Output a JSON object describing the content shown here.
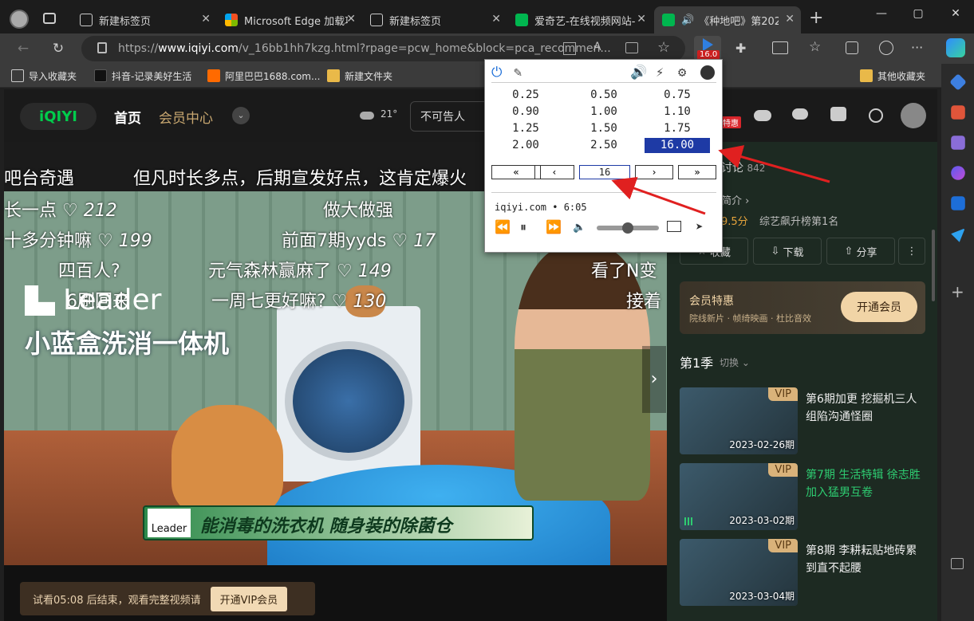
{
  "browser": {
    "tabs": [
      {
        "label": "新建标签页",
        "icon": "new-tab-icon"
      },
      {
        "label": "Microsoft Edge 加载项",
        "icon": "microsoft-logo-icon"
      },
      {
        "label": "新建标签页",
        "icon": "new-tab-icon"
      },
      {
        "label": "爱奇艺-在线视频网站-",
        "icon": "iqiyi-icon"
      },
      {
        "label": "《种地吧》第202",
        "icon": "iqiyi-icon",
        "active": true
      }
    ],
    "url_prefix": "https://",
    "url_host": "www.iqiyi.com",
    "url_path": "/v_16bb1hh7kzg.html?rpage=pcw_home&block=pca_recommen...",
    "extension_badge": "16.0",
    "bookmarks": [
      {
        "label": "导入收藏夹",
        "icon": "import-icon"
      },
      {
        "label": "抖音-记录美好生活",
        "icon": "douyin-icon"
      },
      {
        "label": "阿里巴巴1688.com...",
        "icon": "alibaba-icon"
      },
      {
        "label": "新建文件夹",
        "icon": "folder-icon"
      },
      {
        "label": "其他收藏夹",
        "icon": "folder-icon"
      }
    ]
  },
  "site": {
    "logo": "iQIYI",
    "nav": [
      "首页",
      "会员中心"
    ],
    "weather": "21°",
    "search_value": "不可告人",
    "promo_badge": "特惠"
  },
  "video": {
    "danmu": [
      {
        "text": "吧台奇遇",
        "count": ""
      },
      {
        "text": "但凡时长多点，后期宣发好点，这肯定爆火",
        "count": ""
      },
      {
        "text": "长一点 ♡",
        "count": "212"
      },
      {
        "text": "做大做强",
        "count": ""
      },
      {
        "text": "十多分钟嘛 ♡",
        "count": "199"
      },
      {
        "text": "前面7期yyds ♡",
        "count": "17"
      },
      {
        "text": "四百人?",
        "count": ""
      },
      {
        "text": "元气森林赢麻了 ♡",
        "count": "149"
      },
      {
        "text": "看了N变",
        "count": ""
      },
      {
        "text": "6刷回来",
        "count": ""
      },
      {
        "text": "一周七更好嘛? ♡",
        "count": "130"
      },
      {
        "text": "接着",
        "count": ""
      }
    ],
    "ad_brand": "Leader",
    "ad_slogan": "小蓝盒洗消一体机",
    "ad_banner": "能消毒的洗衣机 随身装的除菌仓",
    "ad_banner_brand": "Leader",
    "trial_text": "试看05:08 后结束，观看完整视频请",
    "trial_button": "开通VIP会员"
  },
  "sidebar": {
    "discuss_label": "讨论",
    "discuss_count": "842",
    "intro_label": "简介 ›",
    "score": "9.5分",
    "rank": "综艺飙升榜第1名",
    "buttons": [
      "收藏",
      "下载",
      "分享",
      "⋮"
    ],
    "vip_title": "会员特惠",
    "vip_sub": "院线新片 · 帧绮映画 · 杜比音效",
    "vip_button": "开通会员",
    "season": "第1季",
    "switch": "切换 ⌄",
    "episodes": [
      {
        "title": "第6期加更 挖掘机三人组陷沟通怪圈",
        "date": "2023-02-26期",
        "badge": "VIP",
        "playing": false
      },
      {
        "title": "第7期 生活特辑 徐志胜加入猛男互卷",
        "date": "2023-03-02期",
        "badge": "VIP",
        "playing": true
      },
      {
        "title": "第8期 李耕耘贴地砖累到直不起腰",
        "date": "2023-03-04期",
        "badge": "VIP",
        "playing": false
      }
    ]
  },
  "popup": {
    "rates": [
      "0.25",
      "0.50",
      "0.75",
      "0.90",
      "1.00",
      "1.10",
      "1.25",
      "1.50",
      "1.75",
      "2.00",
      "2.50",
      "16.00"
    ],
    "selected_rate": "16.00",
    "buttons": [
      "«",
      "‹",
      "›",
      "»"
    ],
    "rate_input": "16",
    "site_info": "iqiyi.com • 6:05",
    "volume_level": 0.5
  },
  "colors": {
    "accent": "#1e3aa5",
    "iqiyi_green": "#00cc4c",
    "vip_gold": "#d9b27a",
    "playing_green": "#2ecc71",
    "arrow_red": "#e02020"
  }
}
